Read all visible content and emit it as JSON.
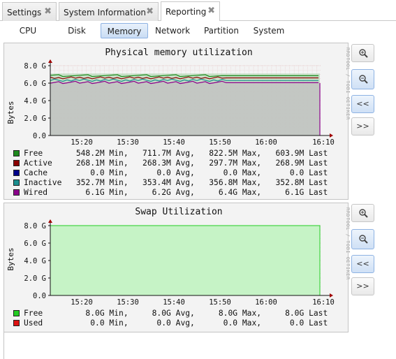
{
  "tabs": [
    {
      "label": "Settings",
      "close": "✖"
    },
    {
      "label": "System Information",
      "close": "✖"
    },
    {
      "label": "Reporting",
      "close": "✖"
    }
  ],
  "subtabs": [
    "CPU",
    "Disk",
    "Memory",
    "Network",
    "Partition",
    "System"
  ],
  "active_subtab": "Memory",
  "side_credit": "RRDTOOL / TOBI OETIKER",
  "buttons": {
    "zoom_in": "zoom-in-icon",
    "zoom_out": "zoom-out-icon",
    "back": "<<",
    "forward": ">>"
  },
  "memory_graph": {
    "title": "Physical memory utilization",
    "ylabel": "Bytes",
    "y_ticks": [
      "8.0 G",
      "6.0 G",
      "4.0 G",
      "2.0 G",
      "0.0"
    ],
    "x_ticks": [
      "15:20",
      "15:30",
      "15:40",
      "15:50",
      "16:00",
      "16:10"
    ],
    "legend": [
      {
        "name": "Free",
        "color": "#1e8a1e",
        "min": "548.2M",
        "avg": "711.7M",
        "max": "822.5M",
        "last": "603.9M"
      },
      {
        "name": "Active",
        "color": "#8b0000",
        "min": "268.1M",
        "avg": "268.3M",
        "max": "297.7M",
        "last": "268.9M"
      },
      {
        "name": "Cache",
        "color": "#00008b",
        "min": "0.0",
        "avg": "0.0",
        "max": "0.0",
        "last": "0.0"
      },
      {
        "name": "Inactive",
        "color": "#1a8f8f",
        "min": "352.7M",
        "avg": "353.4M",
        "max": "356.8M",
        "last": "352.8M"
      },
      {
        "name": "Wired",
        "color": "#8b008b",
        "min": "6.1G",
        "avg": "6.2G",
        "max": "6.4G",
        "last": "6.1G"
      }
    ]
  },
  "swap_graph": {
    "title": "Swap Utilization",
    "ylabel": "Bytes",
    "y_ticks": [
      "8.0 G",
      "6.0 G",
      "4.0 G",
      "2.0 G",
      "0.0"
    ],
    "x_ticks": [
      "15:20",
      "15:30",
      "15:40",
      "15:50",
      "16:00",
      "16:10"
    ],
    "legend": [
      {
        "name": "Free",
        "color": "#22cc22",
        "min": "8.0G",
        "avg": "8.0G",
        "max": "8.0G",
        "last": "8.0G"
      },
      {
        "name": "Used",
        "color": "#dd1111",
        "min": "0.0",
        "avg": "0.0",
        "max": "0.0",
        "last": "0.0"
      }
    ]
  },
  "legend_words": {
    "min": "Min,",
    "avg": "Avg,",
    "max": "Max,",
    "last": "Last"
  }
}
